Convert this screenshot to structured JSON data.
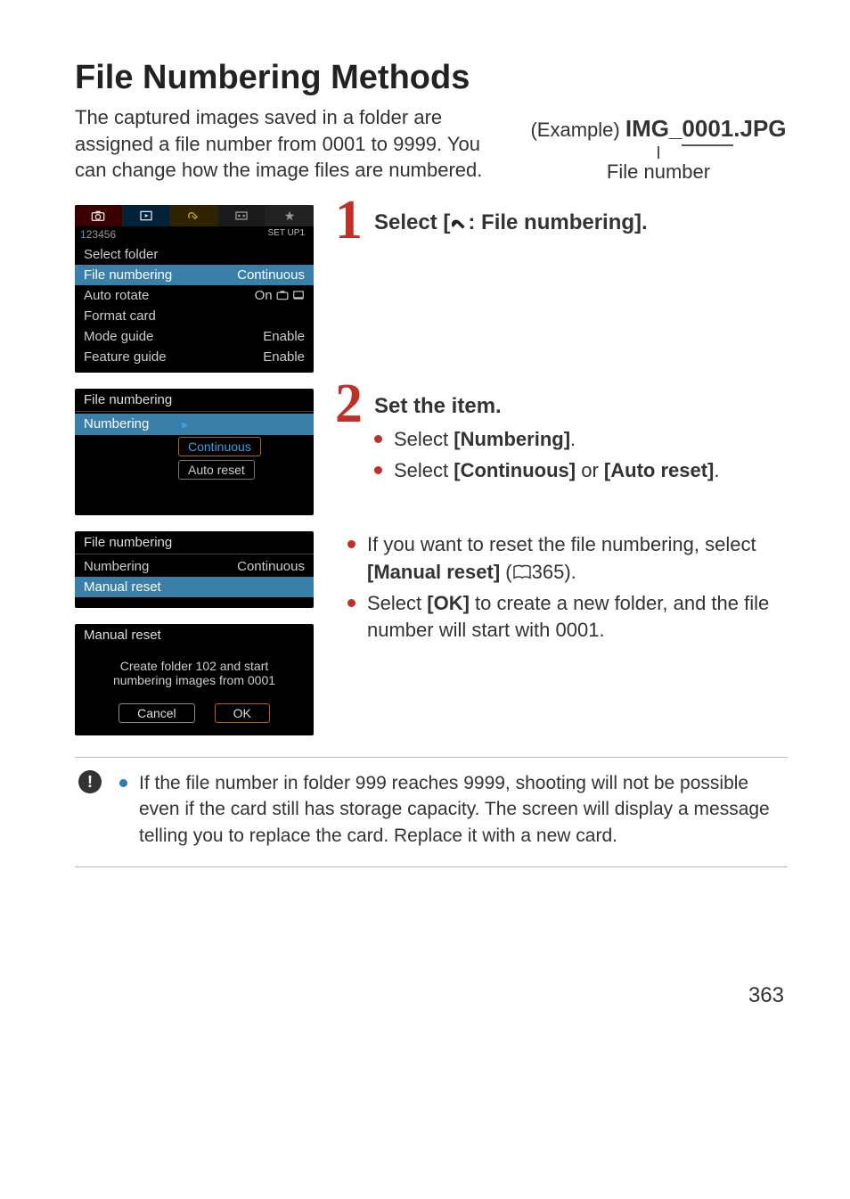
{
  "page": {
    "title": "File Numbering Methods",
    "intro": "The captured images saved in a folder are assigned a file number from 0001 to 9999. You can change how the image files are numbered.",
    "example_prefix": "(Example) ",
    "example_filename_pre": "IMG_",
    "example_filename_num": "0001",
    "example_filename_ext": ".JPG",
    "file_number_label": "File number",
    "page_number": "363"
  },
  "steps": {
    "s1": {
      "num": "1",
      "title_pre": "Select [",
      "title_icon": "wrench-icon",
      "title_post": ": File numbering]."
    },
    "s2": {
      "num": "2",
      "title": "Set the item.",
      "b1_pre": "Select ",
      "b1_bold": "[Numbering]",
      "b1_post": ".",
      "b2_pre": "Select ",
      "b2_bold1": "[Continuous]",
      "b2_mid": " or ",
      "b2_bold2": "[Auto reset]",
      "b2_post": "."
    },
    "s3": {
      "b1_pre": "If you want to reset the file numbering, select ",
      "b1_bold": "[Manual reset]",
      "b1_mid": " (",
      "b1_page": "365",
      "b1_post": ").",
      "b2_pre": "Select ",
      "b2_bold": "[OK]",
      "b2_post": " to create a new folder, and the file number will start with 0001."
    }
  },
  "lcd1": {
    "numrow": {
      "n1": "1",
      "n2": "2",
      "n3": "3",
      "n4": "4",
      "n5": "5",
      "n6": "6",
      "set": "SET UP1"
    },
    "r1": {
      "lbl": "Select folder"
    },
    "r2": {
      "lbl": "File numbering",
      "val": "Continuous"
    },
    "r3": {
      "lbl": "Auto rotate",
      "val": "On"
    },
    "r4": {
      "lbl": "Format card"
    },
    "r5": {
      "lbl": "Mode guide",
      "val": "Enable"
    },
    "r6": {
      "lbl": "Feature guide",
      "val": "Enable"
    }
  },
  "lcd2": {
    "title": "File numbering",
    "row_lbl": "Numbering",
    "opt1": "Continuous",
    "opt2": "Auto reset"
  },
  "lcd3": {
    "title": "File numbering",
    "row1_lbl": "Numbering",
    "row1_val": "Continuous",
    "row2_lbl": "Manual reset"
  },
  "lcd4": {
    "title": "Manual reset",
    "body_l1": "Create folder 102 and start",
    "body_l2": "numbering images from 0001",
    "cancel": "Cancel",
    "ok": "OK"
  },
  "caution": {
    "text": "If the file number in folder 999 reaches 9999, shooting will not be possible even if the card still has storage capacity. The screen will display a message telling you to replace the card. Replace it with a new card."
  }
}
